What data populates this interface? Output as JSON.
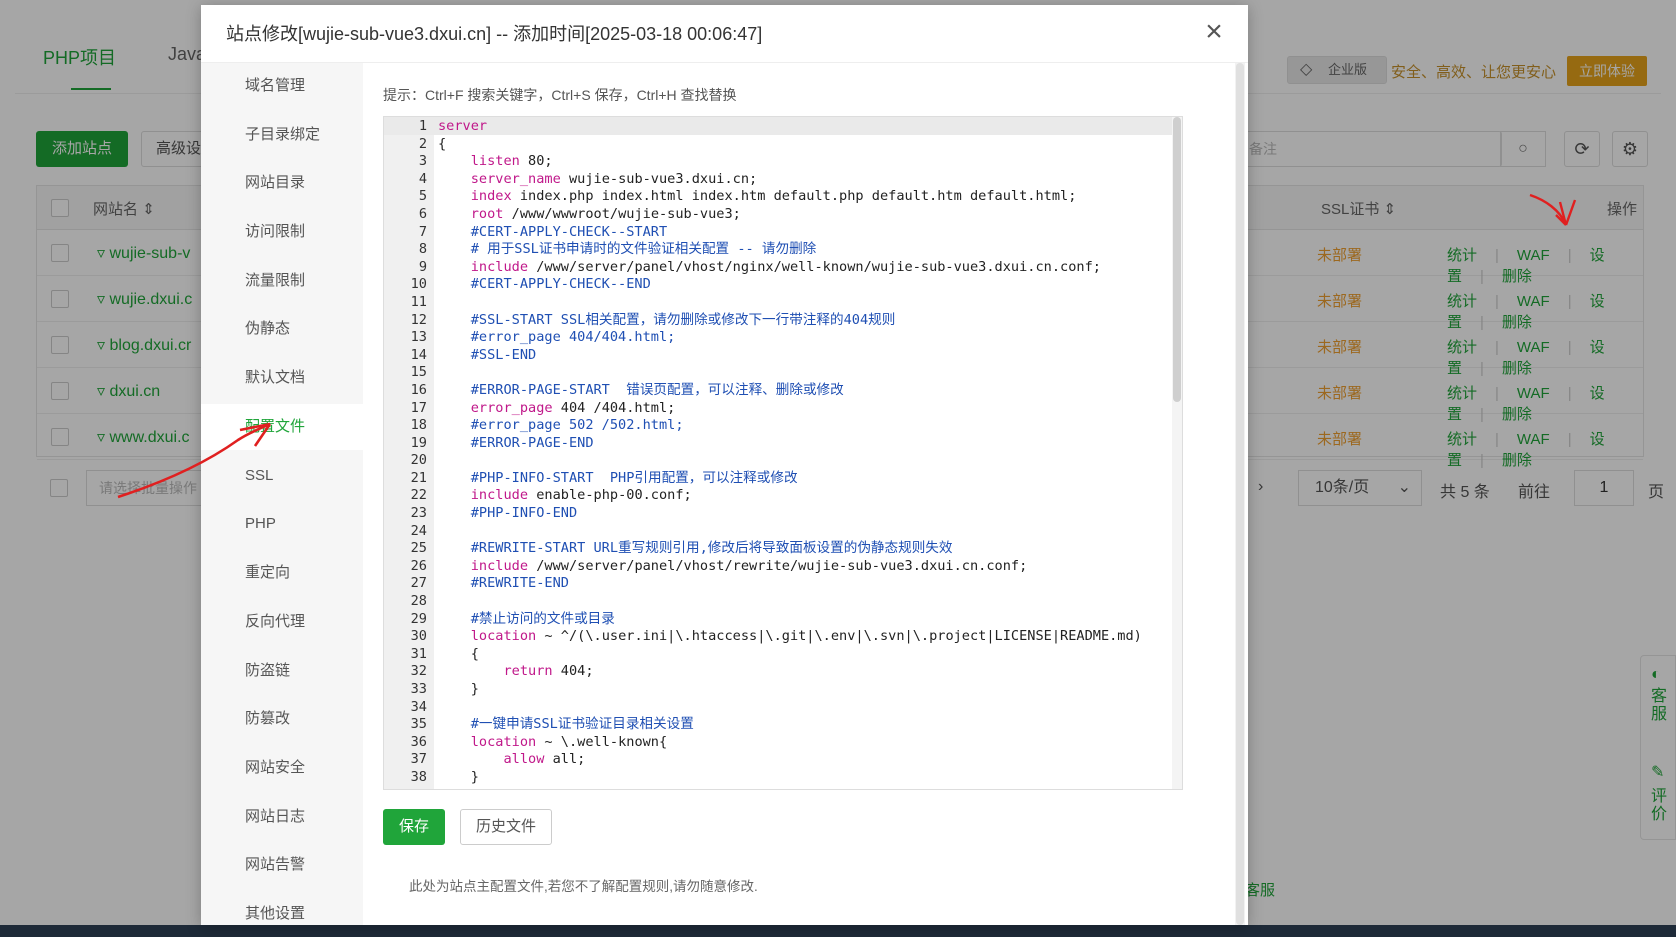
{
  "background": {
    "tabs": [
      "PHP项目",
      "Java"
    ],
    "enterprise_badge": "企业版",
    "enterprise_slogan": "安全、高效、让您更安心",
    "try_button": "立即体验",
    "add_site_button": "添加站点",
    "advanced_button": "高级设",
    "search_placeholder": "备注",
    "columns": {
      "name": "网站名",
      "ssl": "SSL证书",
      "actions": "操作"
    },
    "rows": [
      {
        "name": "wujie-sub-v",
        "ssl": "未部署"
      },
      {
        "name": "wujie.dxui.c",
        "ssl": "未部署"
      },
      {
        "name": "blog.dxui.cr",
        "ssl": "未部署"
      },
      {
        "name": "dxui.cn",
        "ssl": "未部署"
      },
      {
        "name": "www.dxui.c",
        "ssl": "未部署"
      }
    ],
    "row_actions": [
      "统计",
      "WAF",
      "设置",
      "删除"
    ],
    "batch_placeholder": "请选择批量操作",
    "page_size": "10条/页",
    "total": "共 5 条",
    "goto_label": "前往",
    "goto_value": "1",
    "page_unit": "页",
    "service_link": "客服",
    "float_service": "客服",
    "float_review": "评价"
  },
  "modal": {
    "title": "站点修改[wujie-sub-vue3.dxui.cn] -- 添加时间[2025-03-18 00:06:47]",
    "close_icon": "×",
    "menu": [
      "域名管理",
      "子目录绑定",
      "网站目录",
      "访问限制",
      "流量限制",
      "伪静态",
      "默认文档",
      "配置文件",
      "SSL",
      "PHP",
      "重定向",
      "反向代理",
      "防盗链",
      "防篡改",
      "网站安全",
      "网站日志",
      "网站告警",
      "其他设置"
    ],
    "active_menu": "配置文件",
    "hint": "提示：Ctrl+F 搜索关键字，Ctrl+S 保存，Ctrl+H 查找替换",
    "save_button": "保存",
    "history_button": "历史文件",
    "note": "此处为站点主配置文件,若您不了解配置规则,请勿随意修改.",
    "code_lines": [
      "server",
      "{",
      "    listen 80;",
      "    server_name wujie-sub-vue3.dxui.cn;",
      "    index index.php index.html index.htm default.php default.htm default.html;",
      "    root /www/wwwroot/wujie-sub-vue3;",
      "    #CERT-APPLY-CHECK--START",
      "    # 用于SSL证书申请时的文件验证相关配置 -- 请勿删除",
      "    include /www/server/panel/vhost/nginx/well-known/wujie-sub-vue3.dxui.cn.conf;",
      "    #CERT-APPLY-CHECK--END",
      "",
      "    #SSL-START SSL相关配置，请勿删除或修改下一行带注释的404规则",
      "    #error_page 404/404.html;",
      "    #SSL-END",
      "",
      "    #ERROR-PAGE-START  错误页配置，可以注释、删除或修改",
      "    error_page 404 /404.html;",
      "    #error_page 502 /502.html;",
      "    #ERROR-PAGE-END",
      "",
      "    #PHP-INFO-START  PHP引用配置，可以注释或修改",
      "    include enable-php-00.conf;",
      "    #PHP-INFO-END",
      "",
      "    #REWRITE-START URL重写规则引用,修改后将导致面板设置的伪静态规则失效",
      "    include /www/server/panel/vhost/rewrite/wujie-sub-vue3.dxui.cn.conf;",
      "    #REWRITE-END",
      "",
      "    #禁止访问的文件或目录",
      "    location ~ ^/(\\.user.ini|\\.htaccess|\\.git|\\.env|\\.svn|\\.project|LICENSE|README.md)",
      "    {",
      "        return 404;",
      "    }",
      "",
      "    #一键申请SSL证书验证目录相关设置",
      "    location ~ \\.well-known{",
      "        allow all;",
      "    }"
    ]
  },
  "colors": {
    "accent": "#20a53a",
    "warning": "#f0a030",
    "comment": "#1f4fb3",
    "keyword": "#c0188a"
  }
}
